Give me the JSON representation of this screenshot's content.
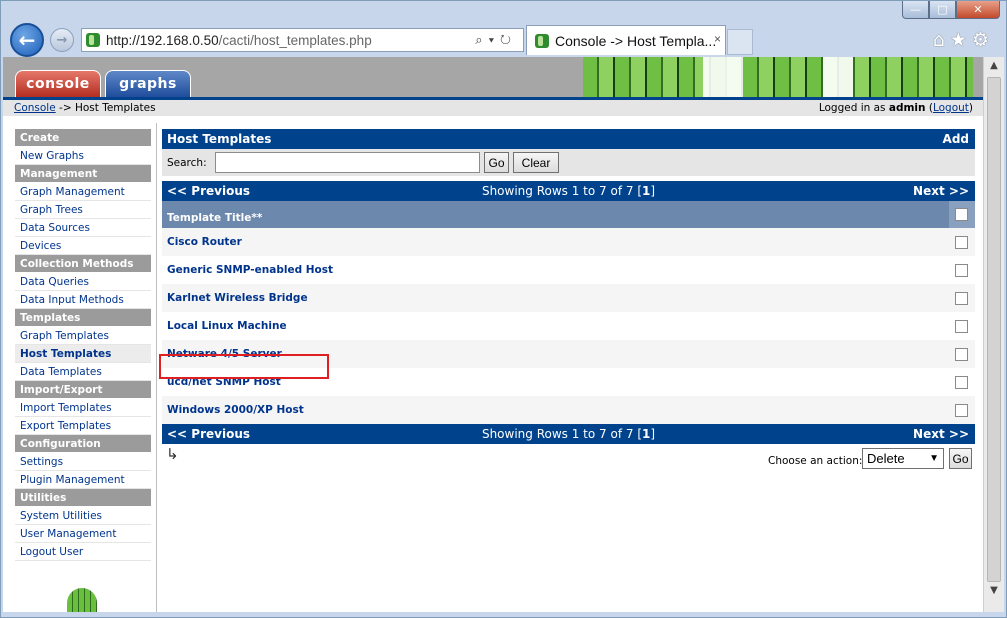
{
  "browser": {
    "url_host": "http://192.168.0.50",
    "url_path": "/cacti/host_templates.php",
    "tab_title": "Console -> Host Templa...",
    "tab_close": "×",
    "window_buttons": {
      "minimize": "—",
      "maximize": "□",
      "close": "✕"
    },
    "icons": [
      "back-arrow-icon",
      "forward-arrow-icon",
      "search-icon",
      "dropdown-icon",
      "refresh-icon",
      "home-icon",
      "star-icon",
      "gear-icon"
    ]
  },
  "topnav": {
    "console_label": "console",
    "graphs_label": "graphs"
  },
  "breadcrumb": {
    "console_link": "Console",
    "separator": " -> ",
    "current": "Host Templates"
  },
  "login": {
    "prefix": "Logged in as ",
    "user": "admin",
    "logout_open": " (",
    "logout_label": "Logout",
    "logout_close": ")"
  },
  "menu": [
    {
      "type": "header",
      "label": "Create"
    },
    {
      "type": "item",
      "label": "New Graphs"
    },
    {
      "type": "header",
      "label": "Management"
    },
    {
      "type": "item",
      "label": "Graph Management"
    },
    {
      "type": "item",
      "label": "Graph Trees"
    },
    {
      "type": "item",
      "label": "Data Sources"
    },
    {
      "type": "item",
      "label": "Devices"
    },
    {
      "type": "header",
      "label": "Collection Methods"
    },
    {
      "type": "item",
      "label": "Data Queries"
    },
    {
      "type": "item",
      "label": "Data Input Methods"
    },
    {
      "type": "header",
      "label": "Templates"
    },
    {
      "type": "item",
      "label": "Graph Templates"
    },
    {
      "type": "item",
      "label": "Host Templates",
      "selected": true
    },
    {
      "type": "item",
      "label": "Data Templates"
    },
    {
      "type": "header",
      "label": "Import/Export"
    },
    {
      "type": "item",
      "label": "Import Templates"
    },
    {
      "type": "item",
      "label": "Export Templates"
    },
    {
      "type": "header",
      "label": "Configuration"
    },
    {
      "type": "item",
      "label": "Settings"
    },
    {
      "type": "item",
      "label": "Plugin Management"
    },
    {
      "type": "header",
      "label": "Utilities"
    },
    {
      "type": "item",
      "label": "System Utilities"
    },
    {
      "type": "item",
      "label": "User Management"
    },
    {
      "type": "item",
      "label": "Logout User"
    }
  ],
  "panel": {
    "title": "Host Templates",
    "add_label": "Add"
  },
  "filter": {
    "search_label": "Search:",
    "search_value": "",
    "go_label": "Go",
    "clear_label": "Clear"
  },
  "pager": {
    "prev_label": "<< Previous",
    "next_label": "Next >>",
    "showing_text": "Showing Rows 1 to 7 of 7 [",
    "page": "1",
    "showing_close": "]"
  },
  "table": {
    "column_header": "Template Title**",
    "rows": [
      "Cisco Router",
      "Generic SNMP-enabled Host",
      "Karlnet Wireless Bridge",
      "Local Linux Machine",
      "Netware 4/5 Server",
      "ucd/net SNMP Host",
      "Windows 2000/XP Host"
    ],
    "highlighted_row": "ucd/net SNMP Host",
    "highlight_color": "#e02020"
  },
  "actions": {
    "arrow_glyph": "↳",
    "choose_label": "Choose an action:",
    "selected_action": "Delete",
    "go_label": "Go"
  },
  "colors": {
    "header_blue": "#00438c",
    "link_blue": "#00348c",
    "column_header": "#6d88ad",
    "menu_header": "#9b9b9b"
  }
}
